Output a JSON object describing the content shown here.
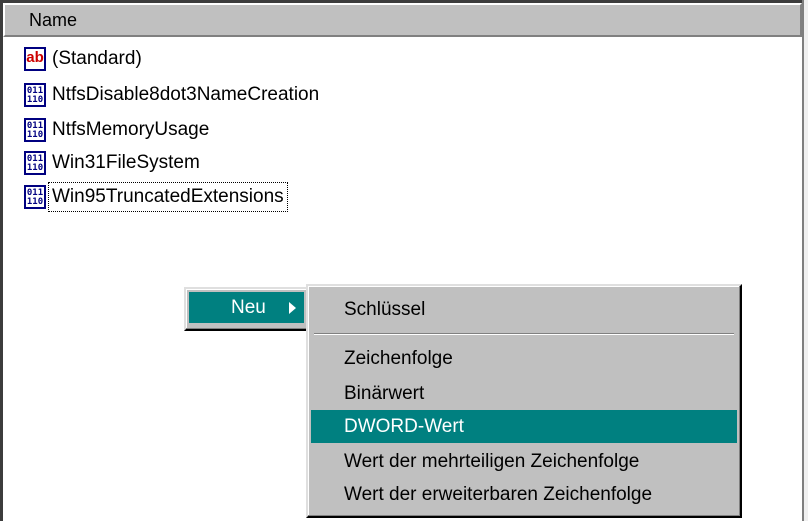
{
  "listview": {
    "column_header": "Name",
    "items": [
      {
        "label": "(Standard)",
        "icon": "string-value-icon"
      },
      {
        "label": "NtfsDisable8dot3NameCreation",
        "icon": "binary-value-icon"
      },
      {
        "label": "NtfsMemoryUsage",
        "icon": "binary-value-icon"
      },
      {
        "label": "Win31FileSystem",
        "icon": "binary-value-icon"
      },
      {
        "label": "Win95TruncatedExtensions",
        "icon": "binary-value-icon"
      }
    ]
  },
  "context_menu": {
    "new_label": "Neu",
    "submenu": {
      "key": "Schlüssel",
      "string": "Zeichenfolge",
      "binary": "Binärwert",
      "dword": "DWORD-Wert",
      "multi_string": "Wert der mehrteiligen Zeichenfolge",
      "expandable_string": "Wert der erweiterbaren Zeichenfolge"
    },
    "selected_item": "DWORD-Wert"
  },
  "icons": {
    "string_icon_text": "ab",
    "binary_icon_text": "011 110"
  },
  "colors": {
    "menu_highlight": "#008080",
    "menu_background": "#c0c0c0",
    "icon_border": "#000080",
    "string_icon_text": "#cc0000"
  }
}
